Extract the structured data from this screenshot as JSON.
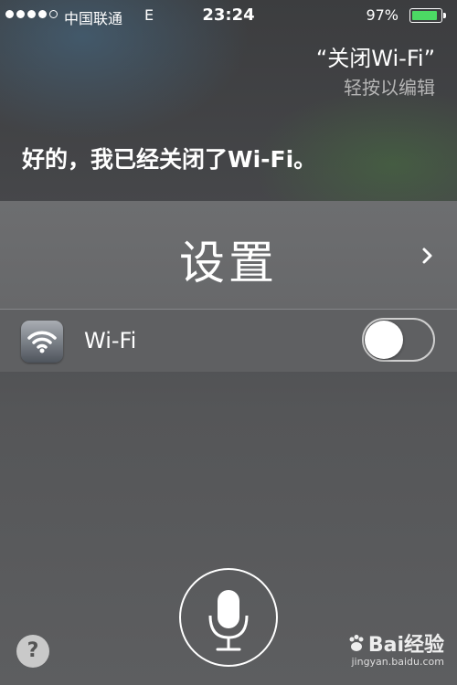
{
  "status_bar": {
    "carrier": "中国联通",
    "network": "E",
    "time": "23:24",
    "battery_percent": "97%",
    "battery_level": 0.97,
    "signal_bars_filled": 4,
    "signal_bars_total": 5,
    "battery_color": "#4cd964"
  },
  "siri": {
    "user_query": "“关闭Wi-Fi”",
    "edit_hint": "轻按以编辑",
    "response": "好的，我已经关闭了Wi-Fi。"
  },
  "settings_card": {
    "title": "设置",
    "wifi_label": "Wi-Fi",
    "wifi_on": false
  },
  "controls": {
    "help_label": "?",
    "mic_icon": "microphone-icon"
  },
  "watermark": {
    "brand": "Bai经验",
    "url": "jingyan.baidu.com"
  }
}
